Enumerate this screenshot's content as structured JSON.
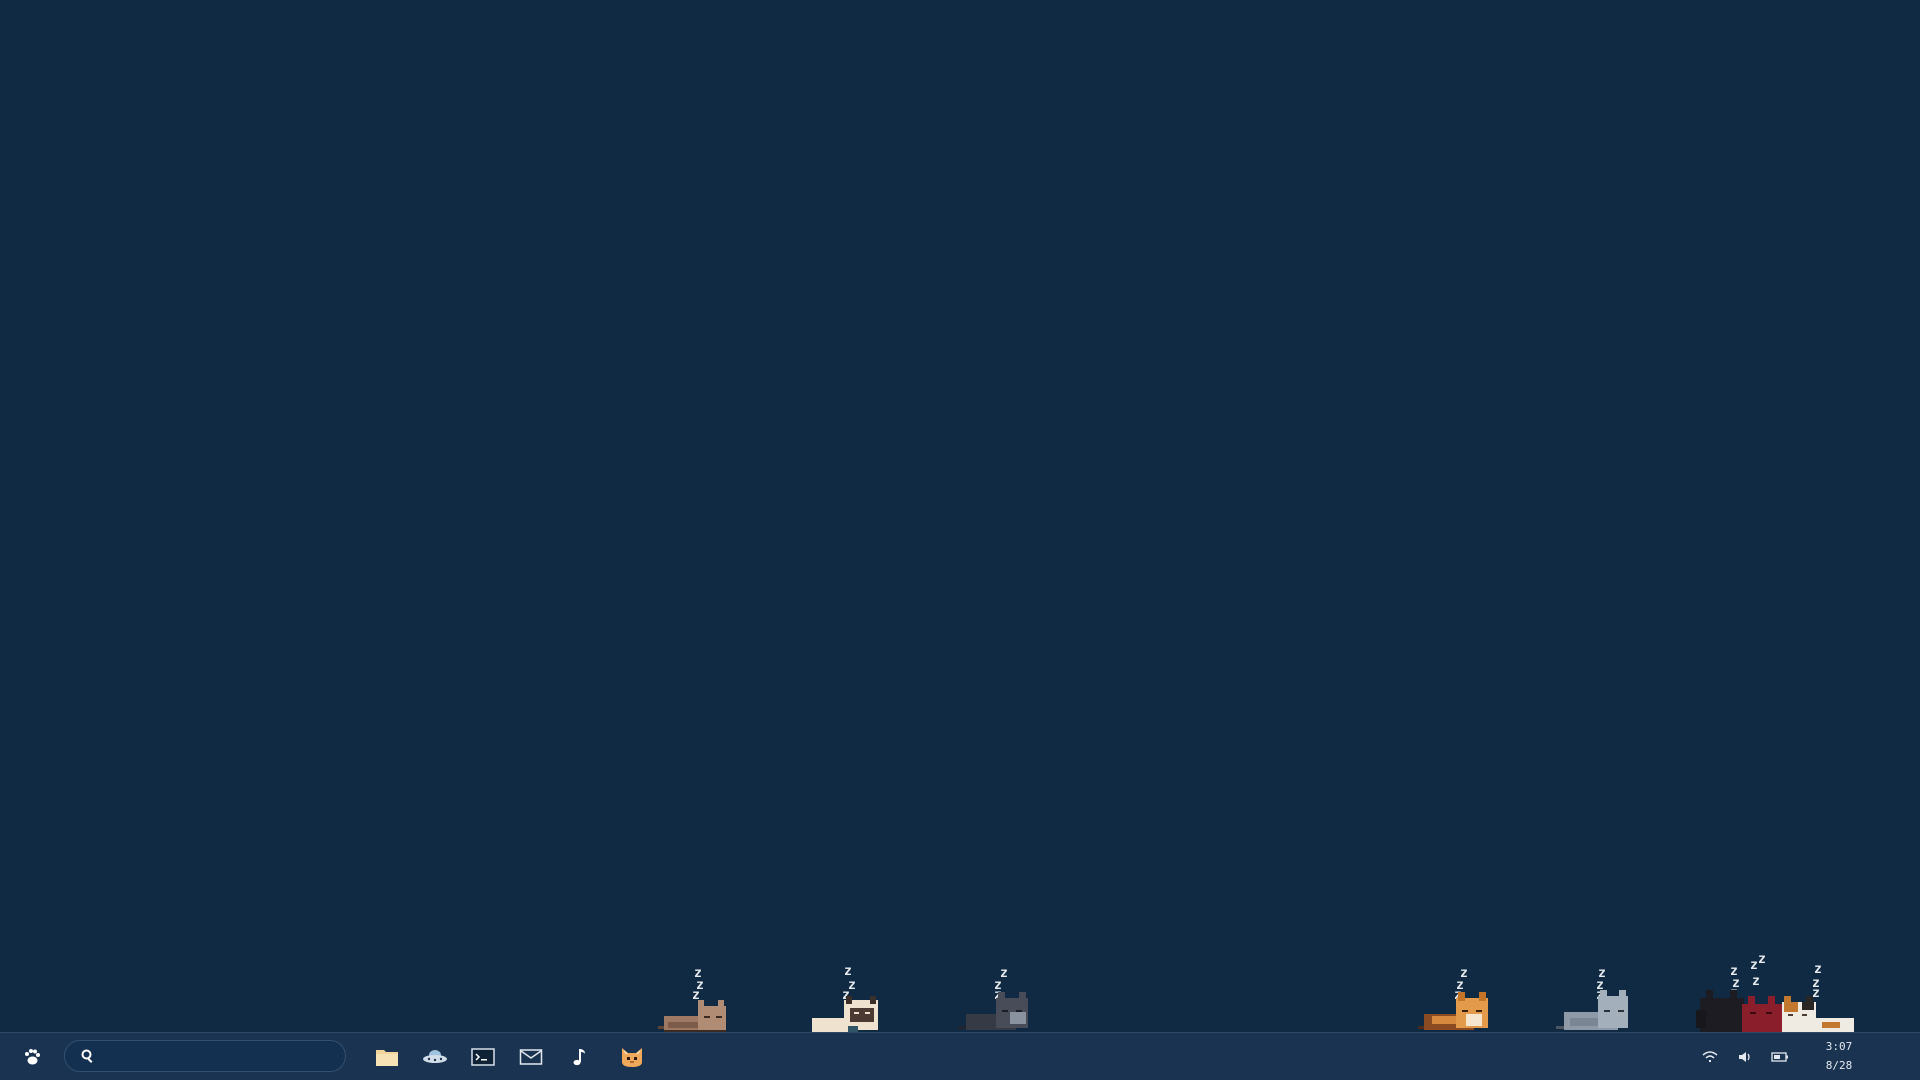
{
  "taskbar": {
    "start_icon": "paw-icon",
    "search": {
      "value": "",
      "placeholder": ""
    },
    "apps": [
      {
        "name": "files",
        "icon": "folder-icon"
      },
      {
        "name": "browser",
        "icon": "ufo-icon"
      },
      {
        "name": "terminal",
        "icon": "terminal-icon"
      },
      {
        "name": "mail",
        "icon": "mail-icon"
      },
      {
        "name": "music",
        "icon": "music-note-icon"
      },
      {
        "name": "cat-app",
        "icon": "cat-face-icon"
      }
    ],
    "tray": {
      "wifi_icon": "wifi-icon",
      "volume_icon": "volume-icon",
      "battery_icon": "battery-icon"
    },
    "clock": {
      "time": "3:07",
      "date": "8/28"
    }
  },
  "cats": {
    "zzz_letter": "z",
    "colors": {
      "brown": "#9e7a64",
      "siamese": "#efe3cf",
      "black": "#363a45",
      "orange": "#d78a3e",
      "gray": "#8e9aa8",
      "dark": "#1c1c22",
      "red": "#8a1e2a",
      "calico": "#f0ebe2"
    }
  },
  "colors": {
    "desktop_bg": "#112a43",
    "taskbar_bg": "#1a3350",
    "accent_orange": "#f0a95a",
    "folder": "#f2d59a"
  }
}
